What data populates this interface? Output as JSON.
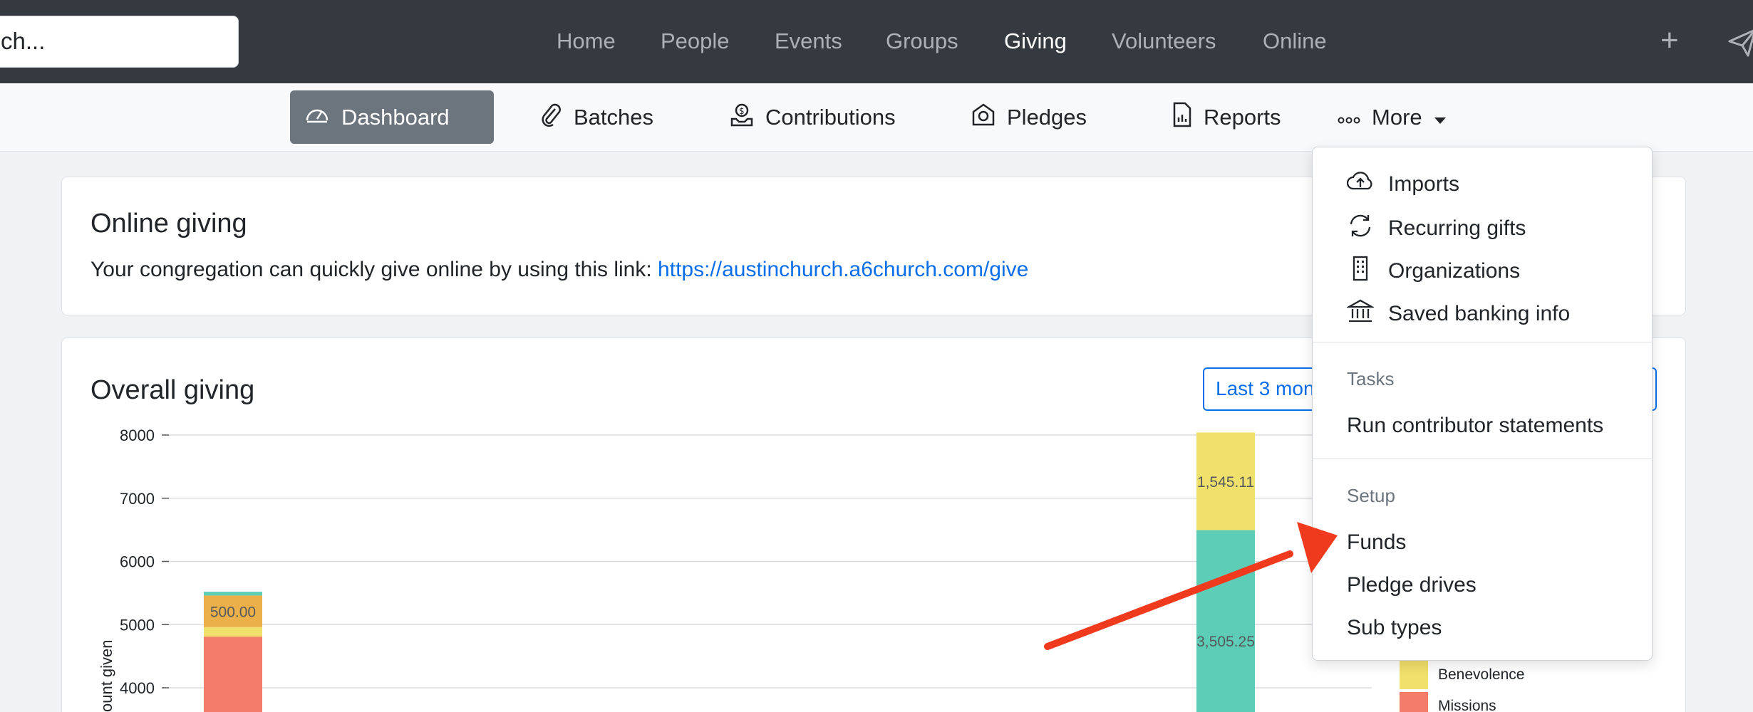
{
  "topbar": {
    "search_text": "ch...",
    "nav": [
      {
        "label": "Home"
      },
      {
        "label": "People"
      },
      {
        "label": "Events"
      },
      {
        "label": "Groups"
      },
      {
        "label": "Giving"
      },
      {
        "label": "Volunteers"
      },
      {
        "label": "Online"
      }
    ],
    "active_nav": "Giving",
    "plus_label": "+"
  },
  "subnav": {
    "items": [
      {
        "label": "Dashboard",
        "icon": "dashboard-gauge-icon"
      },
      {
        "label": "Batches",
        "icon": "paperclip-icon"
      },
      {
        "label": "Contributions",
        "icon": "hand-coin-icon"
      },
      {
        "label": "Pledges",
        "icon": "pledge-icon"
      },
      {
        "label": "Reports",
        "icon": "report-icon"
      },
      {
        "label": "More",
        "icon": "ellipsis-icon"
      }
    ],
    "active": "Dashboard"
  },
  "online_giving": {
    "title": "Online giving",
    "text": "Your congregation can quickly give online by using this link: ",
    "link": "https://austinchurch.a6church.com/give"
  },
  "overall_giving": {
    "title": "Overall giving",
    "range_label": "Last 3 mon"
  },
  "dropdown": {
    "items_top": [
      {
        "label": "Imports",
        "icon": "cloud-upload-icon"
      },
      {
        "label": "Recurring gifts",
        "icon": "refresh-icon"
      },
      {
        "label": "Organizations",
        "icon": "building-icon"
      },
      {
        "label": "Saved banking info",
        "icon": "bank-icon"
      }
    ],
    "tasks_header": "Tasks",
    "tasks_items": [
      {
        "label": "Run contributor statements"
      }
    ],
    "setup_header": "Setup",
    "setup_items": [
      {
        "label": "Funds"
      },
      {
        "label": "Pledge drives"
      },
      {
        "label": "Sub types"
      }
    ]
  },
  "chart_data": {
    "type": "bar",
    "stacked": true,
    "ylabel": "ount given",
    "yticks": [
      4000,
      5000,
      6000,
      7000,
      8000
    ],
    "ylim": [
      3600,
      8000
    ],
    "series_colors": {
      "Missions": "#f47c6a",
      "Benevolence": "#f0e06c",
      "Teal": "#5ecdb8",
      "Orange": "#ebb04a"
    },
    "bars": [
      {
        "segments": [
          {
            "series": "Missions",
            "value": 4810,
            "label": ""
          },
          {
            "series": "Benevolence",
            "value": 150,
            "label": ""
          },
          {
            "series": "Orange",
            "value": 500,
            "label": "500.00"
          },
          {
            "series": "Teal",
            "value": 60,
            "label": ""
          }
        ]
      },
      {
        "segments": [
          {
            "series": "Teal",
            "value": 6494.89,
            "label": "3,505.25"
          },
          {
            "series": "Benevolence",
            "value": 1545.11,
            "label": "1,545.11"
          }
        ]
      }
    ],
    "legend": [
      {
        "name": "Benevolence",
        "color": "#f0e06c"
      },
      {
        "name": "Missions",
        "color": "#f47c6a"
      }
    ]
  },
  "colors": {
    "topbar": "#343a40",
    "accent_link": "#0a6ee8",
    "arrow": "#f03a1e",
    "active_subnav": "#6c757d"
  }
}
